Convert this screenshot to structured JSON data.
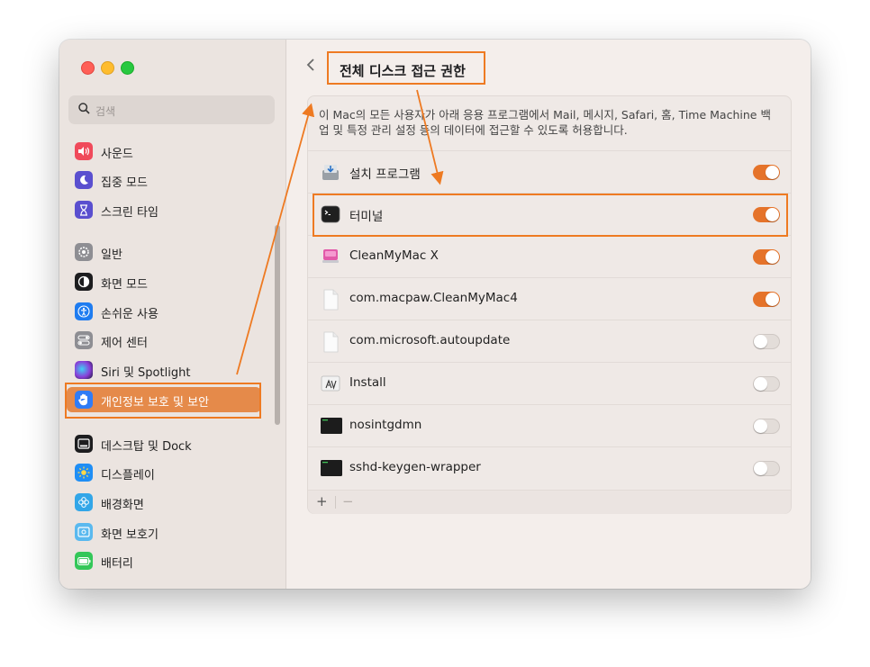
{
  "window": {
    "title": "전체 디스크 접근 권한"
  },
  "sidebar": {
    "search_placeholder": "검색",
    "items": [
      {
        "label": "사운드",
        "icon": "speaker-icon",
        "color": "#f04a5b"
      },
      {
        "label": "집중 모드",
        "icon": "moon-icon",
        "color": "#5a4fcf"
      },
      {
        "label": "스크린 타임",
        "icon": "hourglass-icon",
        "color": "#5a4fcf"
      },
      {
        "label": "일반",
        "icon": "gear-icon",
        "color": "#8e8e93"
      },
      {
        "label": "화면 모드",
        "icon": "appearance-icon",
        "color": "#1d1d1f"
      },
      {
        "label": "손쉬운 사용",
        "icon": "accessibility-icon",
        "color": "#1f7cf0"
      },
      {
        "label": "제어 센터",
        "icon": "control-center-icon",
        "color": "#8e8e93"
      },
      {
        "label": "Siri 및 Spotlight",
        "icon": "siri-icon",
        "color": "#3a2a6e"
      },
      {
        "label": "개인정보 보호 및 보안",
        "icon": "hand-icon",
        "color": "#2f7cf6",
        "selected": true
      },
      {
        "label": "데스크탑 및 Dock",
        "icon": "dock-icon",
        "color": "#1d1d1f"
      },
      {
        "label": "디스플레이",
        "icon": "sun-icon",
        "color": "#1f8ef5"
      },
      {
        "label": "배경화면",
        "icon": "flower-icon",
        "color": "#32a6e8"
      },
      {
        "label": "화면 보호기",
        "icon": "screensaver-icon",
        "color": "#5ab9ef"
      },
      {
        "label": "배터리",
        "icon": "battery-icon",
        "color": "#34c759"
      }
    ]
  },
  "main": {
    "description": "이 Mac의 모든 사용자가 아래 응용 프로그램에서 Mail, 메시지, Safari, 홈, Time Machine 백업 및 특정 관리 설정 등의 데이터에 접근할 수 있도록 허용합니다.",
    "apps": [
      {
        "name": "설치 프로그램",
        "icon": "installer-icon",
        "enabled": true
      },
      {
        "name": "터미널",
        "icon": "terminal-icon",
        "enabled": true
      },
      {
        "name": "CleanMyMac X",
        "icon": "cleanmymac-icon",
        "enabled": true
      },
      {
        "name": "com.macpaw.CleanMyMac4",
        "icon": "document-icon",
        "enabled": true
      },
      {
        "name": "com.microsoft.autoupdate",
        "icon": "document-icon",
        "enabled": false
      },
      {
        "name": "Install",
        "icon": "install-app-icon",
        "enabled": false
      },
      {
        "name": "nosintgdmn",
        "icon": "exec-icon",
        "enabled": false
      },
      {
        "name": "sshd-keygen-wrapper",
        "icon": "exec-icon",
        "enabled": false
      }
    ],
    "footer": {
      "add_label": "+",
      "remove_label": "−"
    }
  },
  "colors": {
    "accent": "#e5732a",
    "annotation": "#ee7a22"
  }
}
